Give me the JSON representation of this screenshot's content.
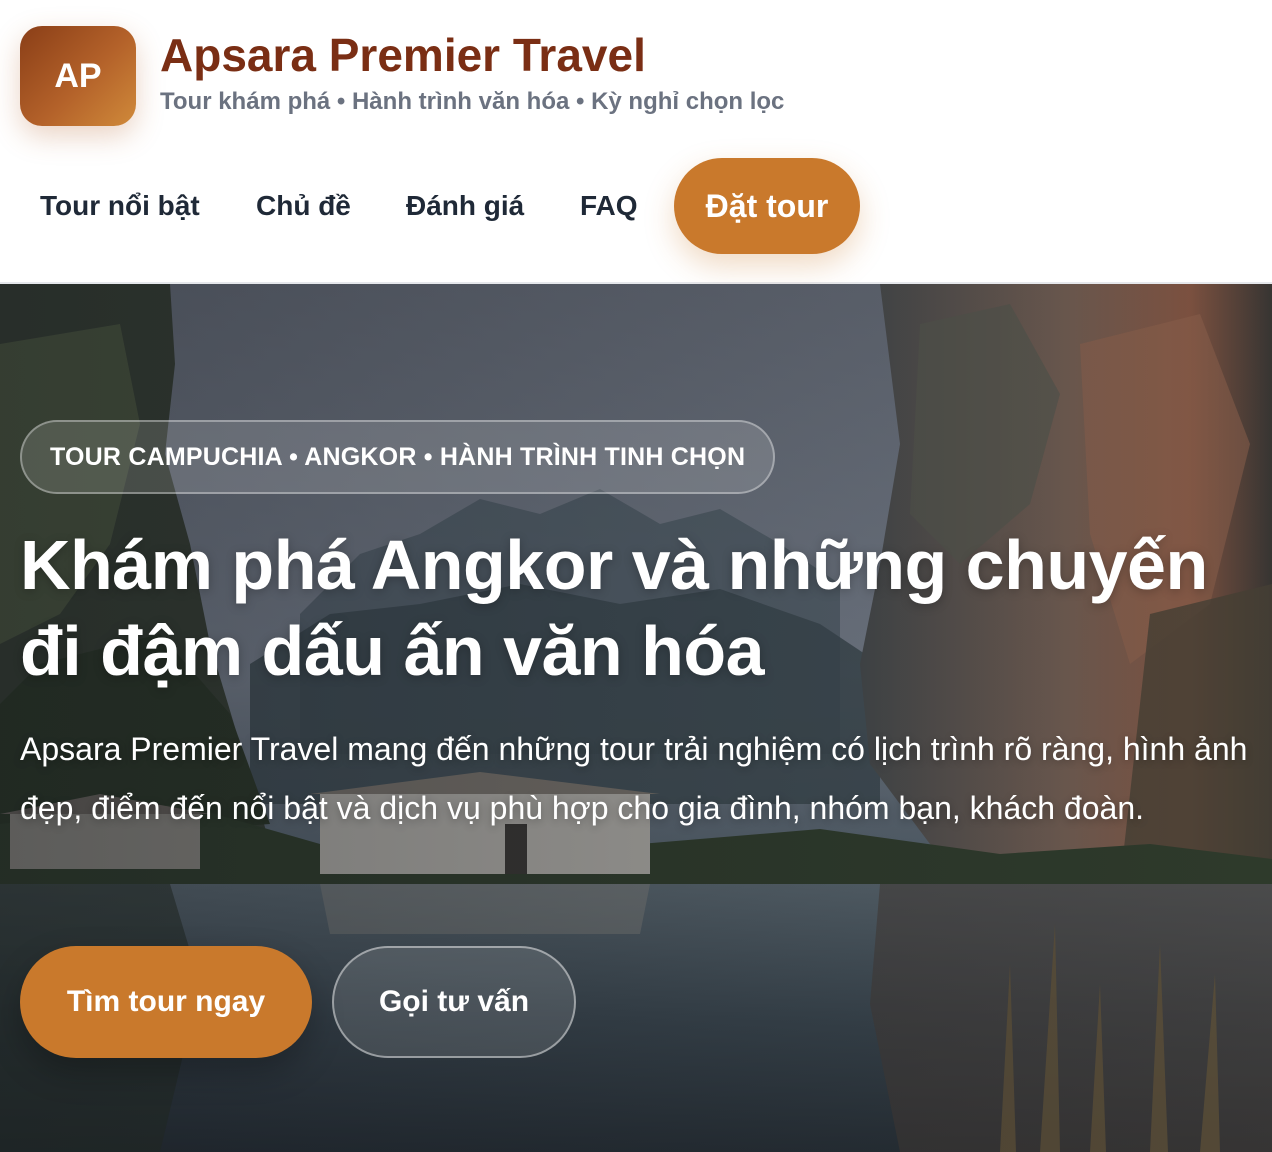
{
  "brand": {
    "logo_initials": "AP",
    "name": "Apsara Premier Travel",
    "tagline": "Tour khám phá • Hành trình văn hóa • Kỳ nghỉ chọn lọc"
  },
  "nav": {
    "items": [
      {
        "label": "Tour nổi bật"
      },
      {
        "label": "Chủ đề"
      },
      {
        "label": "Đánh giá"
      },
      {
        "label": "FAQ"
      }
    ],
    "cta_label": "Đặt tour"
  },
  "hero": {
    "eyebrow": "TOUR CAMPUCHIA • ANGKOR • HÀNH TRÌNH TINH CHỌN",
    "title": "Khám phá Angkor và những chuyến đi đậm dấu ấn văn hóa",
    "description": "Apsara Premier Travel mang đến những tour trải nghiệm có lịch trình rõ ràng, hình ảnh đẹp, điểm đến nổi bật và dịch vụ phù hợp cho gia đình, nhóm bạn, khách đoàn.",
    "primary_button": "Tìm tour ngay",
    "secondary_button": "Gọi tư vấn"
  },
  "colors": {
    "brand_dark": "#7a2e14",
    "accent": "#c9792c",
    "muted_text": "#6b7280",
    "nav_text": "#1f2937"
  }
}
